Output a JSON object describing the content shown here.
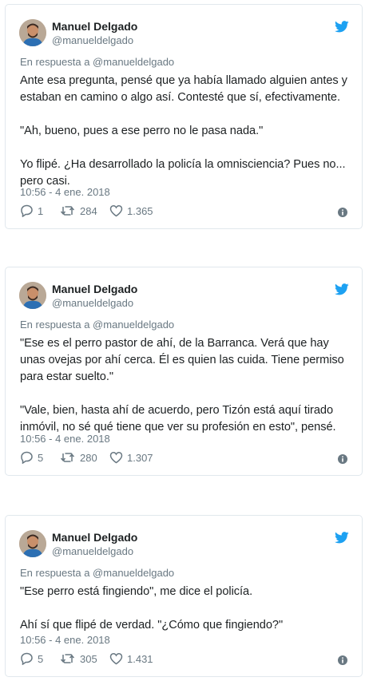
{
  "colors": {
    "twitter_blue": "#1da1f2",
    "muted": "#697882",
    "text": "#1c2022",
    "border": "#e1e8ed"
  },
  "tweets": [
    {
      "name": "Manuel Delgado",
      "handle": "@manueldelgado",
      "reply_to": "En respuesta a @manueldelgado",
      "text": "Ante esa pregunta, pensé que ya había llamado alguien antes y estaban en camino o algo así. Contesté que sí, efectivamente.\n\n\"Ah, bueno, pues a ese perro no le pasa nada.\"\n\nYo flipé. ¿Ha desarrollado la policía la omnisciencia? Pues no... pero casi.",
      "timestamp": "10:56 - 4 ene. 2018",
      "replies": "1",
      "retweets": "284",
      "likes": "1.365"
    },
    {
      "name": "Manuel Delgado",
      "handle": "@manueldelgado",
      "reply_to": "En respuesta a @manueldelgado",
      "text": "\"Ese es el perro pastor de ahí, de la Barranca. Verá que hay unas ovejas por ahí cerca. Él es quien las cuida. Tiene permiso para estar suelto.\"\n\n\"Vale, bien, hasta ahí de acuerdo, pero Tizón está aquí tirado inmóvil, no sé qué tiene que ver su profesión en esto\", pensé.",
      "timestamp": "10:56 - 4 ene. 2018",
      "replies": "5",
      "retweets": "280",
      "likes": "1.307"
    },
    {
      "name": "Manuel Delgado",
      "handle": "@manueldelgado",
      "reply_to": "En respuesta a @manueldelgado",
      "text": "\"Ese perro está fingiendo\", me dice el policía.\n\nAhí sí que flipé de verdad. \"¿Cómo que fingiendo?\"",
      "timestamp": "10:56 - 4 ene. 2018",
      "replies": "5",
      "retweets": "305",
      "likes": "1.431"
    }
  ]
}
